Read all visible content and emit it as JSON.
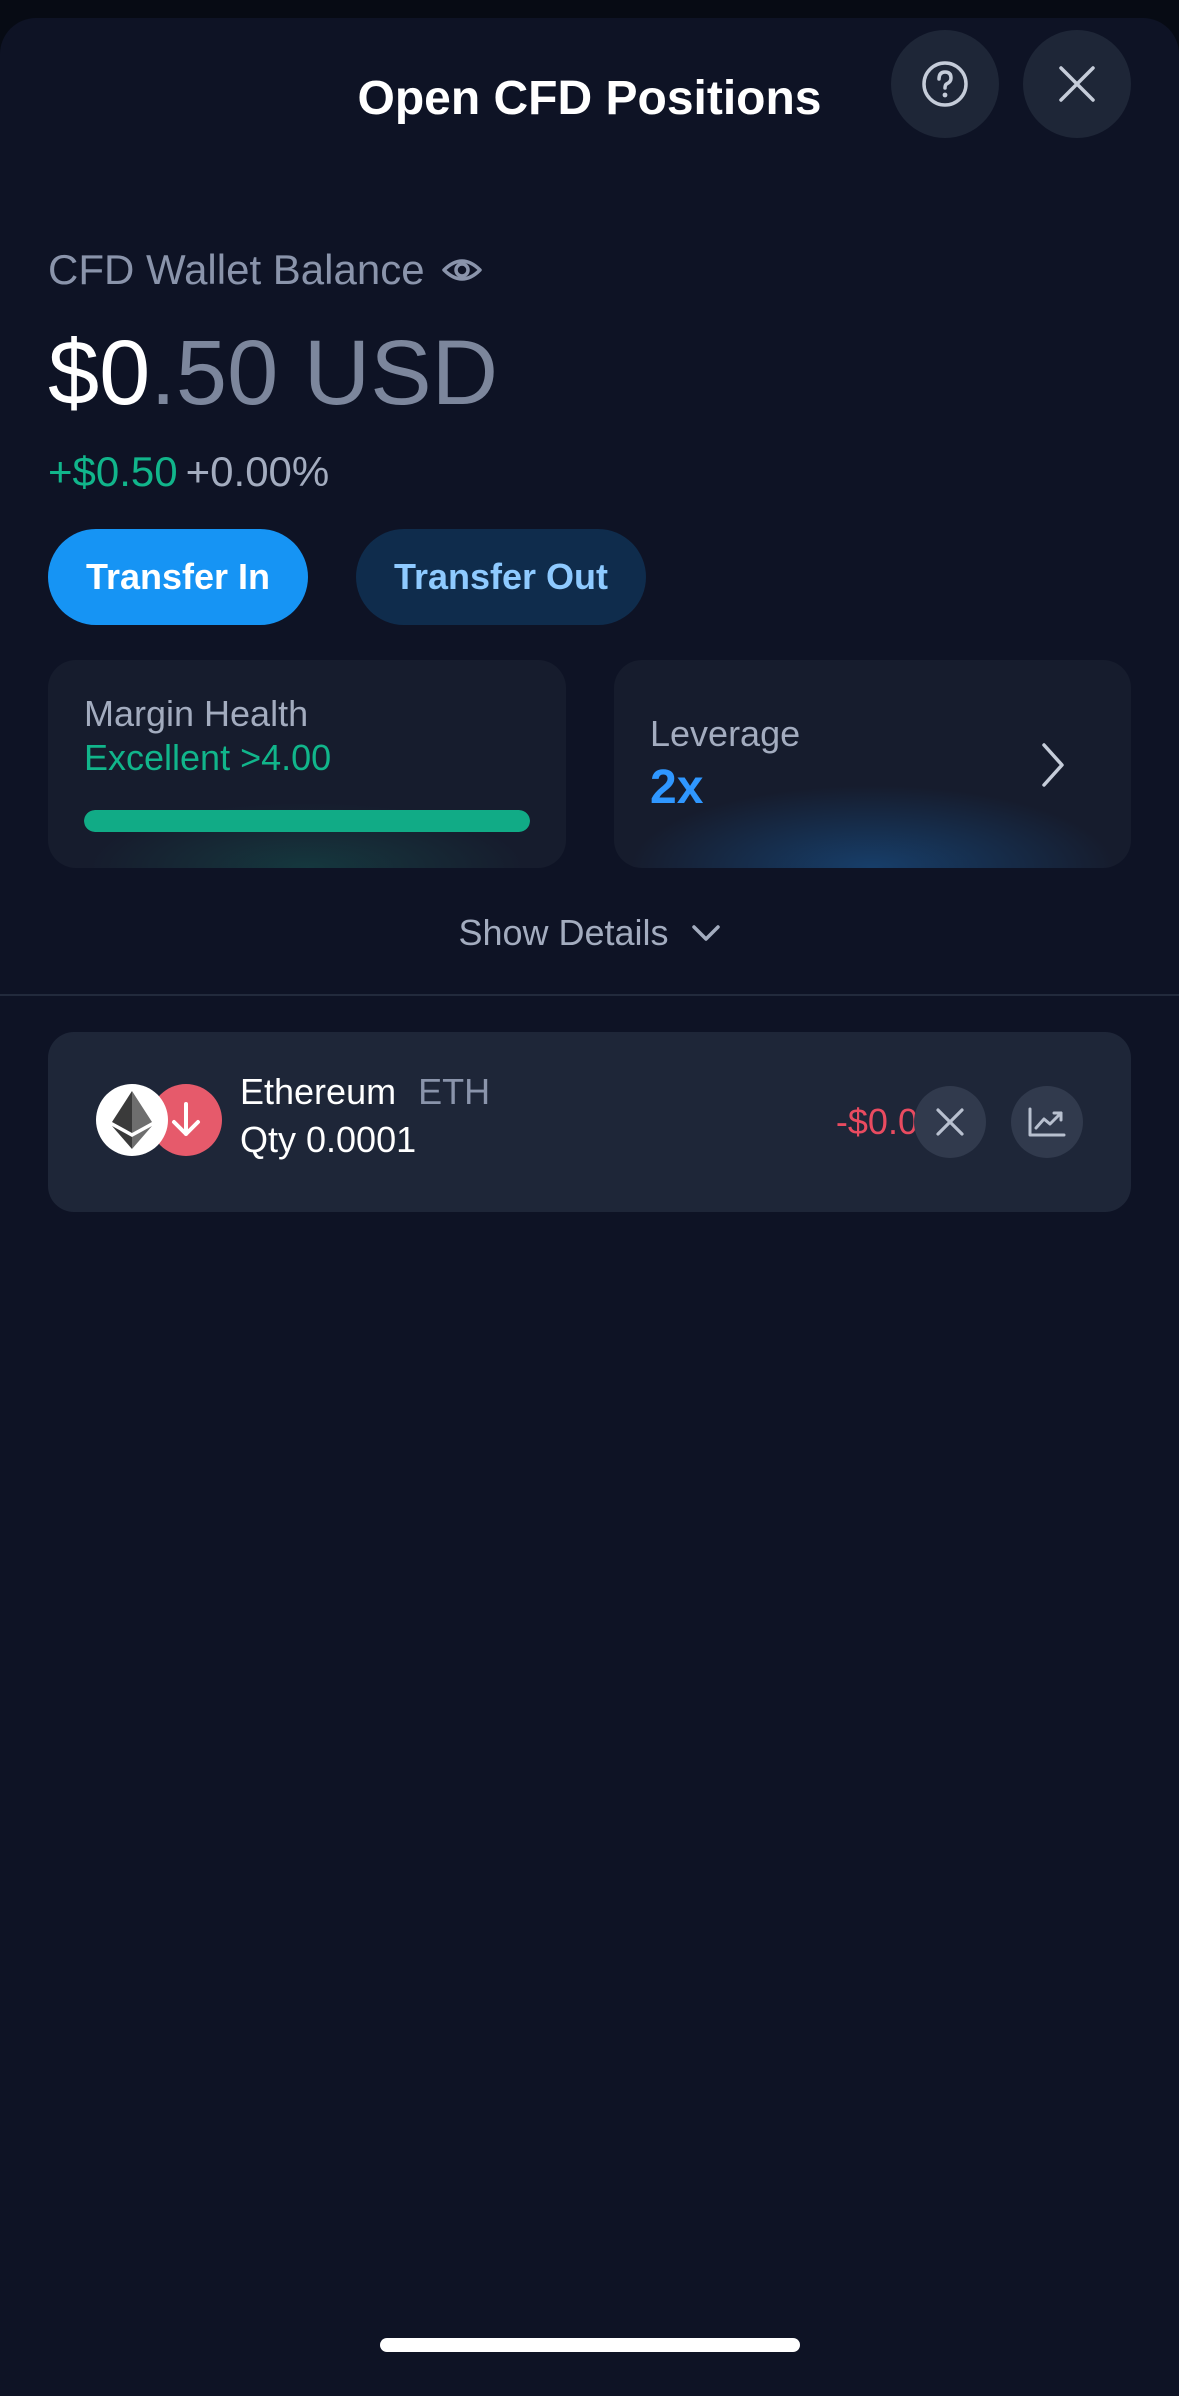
{
  "header": {
    "title": "Open CFD Positions",
    "help_icon": "question-circle-icon",
    "close_icon": "close-icon"
  },
  "wallet": {
    "label": "CFD Wallet Balance",
    "visibility_icon": "eye-icon",
    "balance_integer": "$0",
    "balance_decimal": ".50 USD",
    "change_amount": "+$0.50",
    "change_percent": "+0.00%"
  },
  "actions": {
    "transfer_in": "Transfer In",
    "transfer_out": "Transfer Out"
  },
  "margin": {
    "label": "Margin Health",
    "status": "Excellent >4.00",
    "health_fill_percent": 100
  },
  "leverage": {
    "label": "Leverage",
    "value": "2x"
  },
  "details": {
    "label": "Show Details"
  },
  "positions": [
    {
      "name": "Ethereum",
      "symbol": "ETH",
      "qty": "Qty 0.0001",
      "pnl": "-$0.00",
      "direction": "short"
    }
  ],
  "colors": {
    "background": "#0e1325",
    "accent": "#1694f4",
    "positive": "#11b58b",
    "negative": "#e94b60"
  }
}
